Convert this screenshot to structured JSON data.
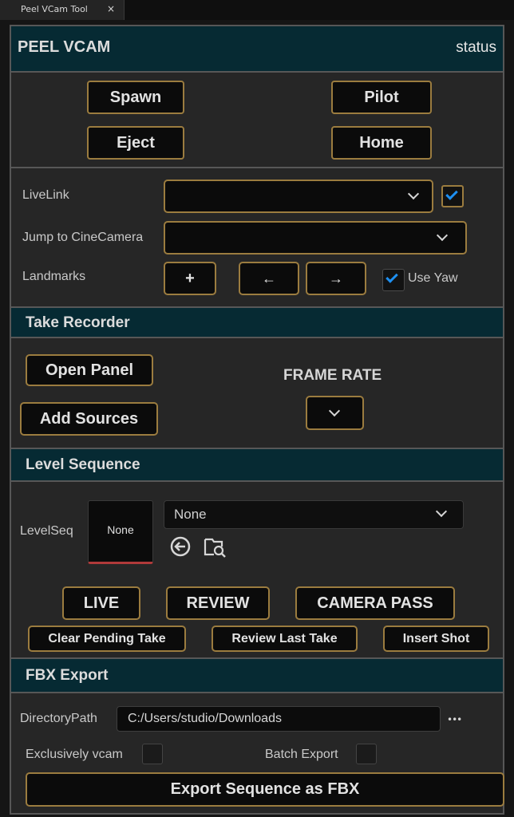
{
  "window": {
    "tab_title": "Peel VCam Tool",
    "tab_close": "×"
  },
  "header": {
    "title": "PEEL VCAM",
    "status": "status"
  },
  "controls": {
    "spawn": "Spawn",
    "pilot": "Pilot",
    "eject": "Eject",
    "home": "Home"
  },
  "livelink": {
    "label": "LiveLink",
    "value": "",
    "enabled": true
  },
  "cinecamera": {
    "label": "Jump to CineCamera",
    "value": ""
  },
  "landmarks": {
    "label": "Landmarks",
    "add": "+",
    "prev": "←",
    "next": "→",
    "use_yaw_label": "Use Yaw",
    "use_yaw": true
  },
  "take_recorder": {
    "title": "Take Recorder",
    "open_panel": "Open Panel",
    "add_sources": "Add Sources",
    "frame_rate_label": "FRAME RATE",
    "frame_rate_value": ""
  },
  "level_sequence": {
    "title": "Level Sequence",
    "label": "LevelSeq",
    "thumbnail": "None",
    "selected": "None",
    "live": "LIVE",
    "review": "REVIEW",
    "camera_pass": "CAMERA PASS",
    "clear_pending": "Clear Pending Take",
    "review_last": "Review Last Take",
    "insert_shot": "Insert Shot"
  },
  "fbx_export": {
    "title": "FBX Export",
    "directory_label": "DirectoryPath",
    "directory_value": "C:/Users/studio/Downloads",
    "more": "•••",
    "exclusive_label": "Exclusively vcam",
    "exclusive": false,
    "batch_label": "Batch Export",
    "batch": false,
    "export_button": "Export Sequence as FBX"
  },
  "colors": {
    "section_bg": "#062a33",
    "button_border": "#9b7c3f",
    "accent": "#1e8ff0"
  }
}
